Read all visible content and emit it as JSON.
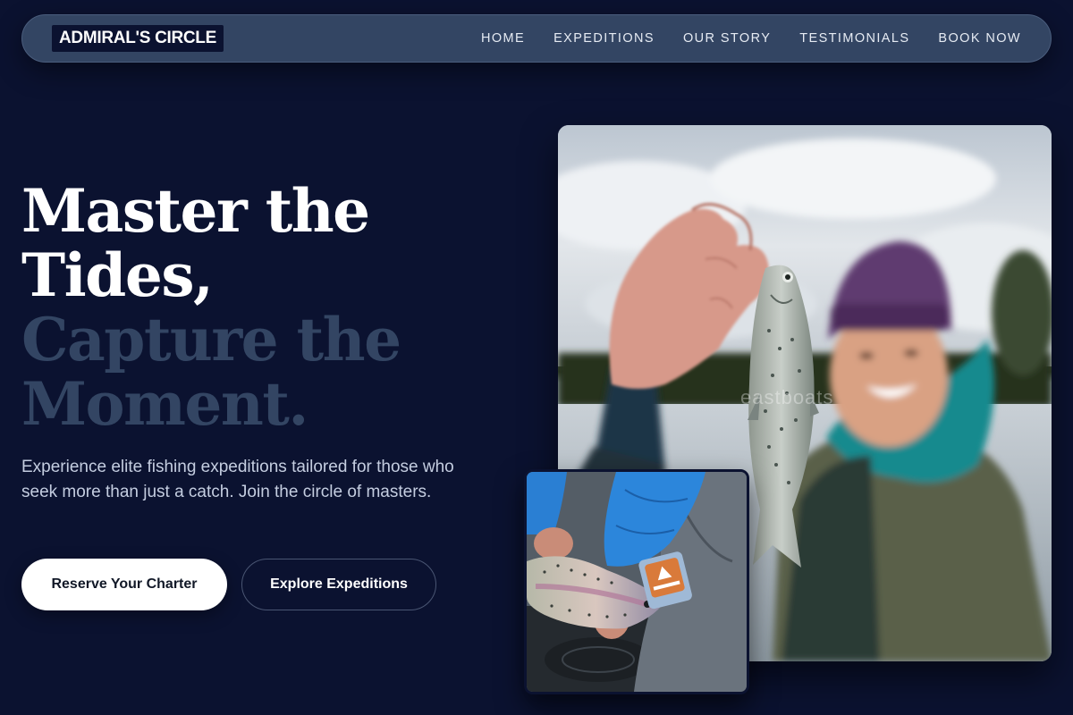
{
  "nav": {
    "logo": "ADMIRAL'S CIRCLE",
    "links": [
      "HOME",
      "EXPEDITIONS",
      "OUR STORY",
      "TESTIMONIALS",
      "BOOK NOW"
    ]
  },
  "hero": {
    "headline_line1": "Master the",
    "headline_line2": "Tides,",
    "headline_line3": "Capture the",
    "headline_line4": "Moment.",
    "subtext": "Experience elite fishing expeditions tailored for those who seek more than just a catch. Join the circle of masters.",
    "primary_button": "Reserve Your Charter",
    "secondary_button": "Explore Expeditions"
  },
  "images": {
    "main_watermark": "eastboats"
  },
  "colors": {
    "background": "#0b1230",
    "navbar": "#334563",
    "headline_dim": "#334563"
  }
}
